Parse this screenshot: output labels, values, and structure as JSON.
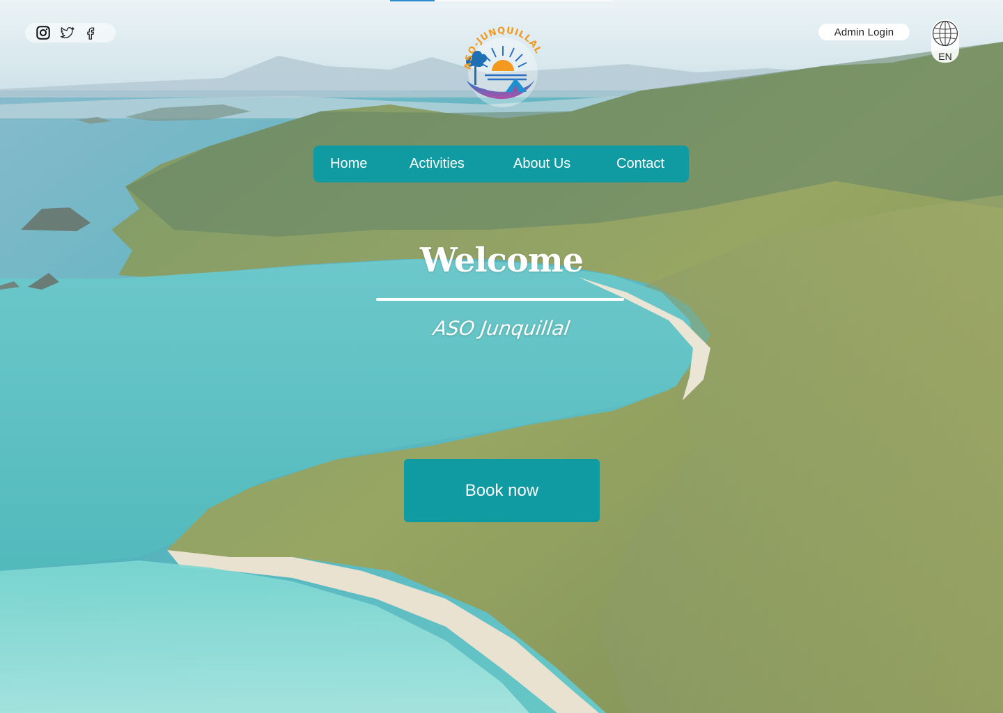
{
  "social": {
    "icons": [
      "instagram-icon",
      "twitter-icon",
      "facebook-icon"
    ]
  },
  "logo": {
    "text": "ASO-JUNQUILLAL"
  },
  "header": {
    "admin_login": "Admin Login",
    "language": "EN",
    "language_icon": "globe-icon"
  },
  "nav": {
    "items": [
      {
        "label": "Home"
      },
      {
        "label": "Activities"
      },
      {
        "label": "About Us"
      },
      {
        "label": "Contact"
      }
    ]
  },
  "hero": {
    "title": "Welcome",
    "subtitle": "ASO Junquillal",
    "cta": "Book now"
  },
  "colors": {
    "accent": "#109aa2",
    "text_light": "#ffffff"
  }
}
